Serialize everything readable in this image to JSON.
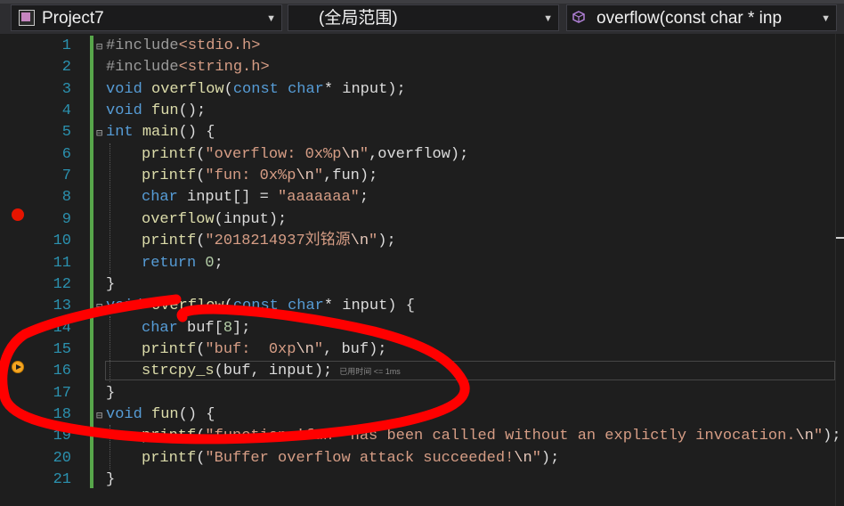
{
  "navbar": {
    "project": "Project7",
    "scope": "(全局范围)",
    "member": "overflow(const char * inp"
  },
  "editor": {
    "hint": "已用时间 <= 1ms",
    "lines": [
      {
        "n": "1",
        "text": "#include<stdio.h>"
      },
      {
        "n": "2",
        "text": "#include<string.h>"
      },
      {
        "n": "3",
        "text": "void overflow(const char* input);"
      },
      {
        "n": "4",
        "text": "void fun();"
      },
      {
        "n": "5",
        "text": "int main() {"
      },
      {
        "n": "6",
        "text": "printf(\"overflow: 0x%p\\n\",overflow);"
      },
      {
        "n": "7",
        "text": "printf(\"fun: 0x%p\\n\",fun);"
      },
      {
        "n": "8",
        "text": "char input[] = \"aaaaaaa\";"
      },
      {
        "n": "9",
        "text": "overflow(input);"
      },
      {
        "n": "10",
        "text": "printf(\"2018214937刘铭源\\n\");"
      },
      {
        "n": "11",
        "text": "return 0;"
      },
      {
        "n": "12",
        "text": "}"
      },
      {
        "n": "13",
        "text": "void overflow(const char* input) {"
      },
      {
        "n": "14",
        "text": "char buf[8];"
      },
      {
        "n": "15",
        "text": "printf(\"buf:  0xp\\n\", buf);"
      },
      {
        "n": "16",
        "text": "strcpy_s(buf, input);"
      },
      {
        "n": "17",
        "text": "}"
      },
      {
        "n": "18",
        "text": "void fun() {"
      },
      {
        "n": "19",
        "text": "printf(\"function 'fun' has been callled without an explictly invocation.\\n\");"
      },
      {
        "n": "20",
        "text": "printf(\"Buffer overflow attack succeeded!\\n\");"
      },
      {
        "n": "21",
        "text": "}"
      }
    ]
  },
  "colors": {
    "keyword": "#569cd6",
    "function": "#dcdcaa",
    "string": "#d69d85",
    "line_number": "#2b91af",
    "annotation": "#ff0000",
    "breakpoint": "#e51400"
  },
  "icons": [
    "project-icon",
    "cube-icon",
    "breakpoint-icon",
    "current-statement-arrow-icon"
  ]
}
